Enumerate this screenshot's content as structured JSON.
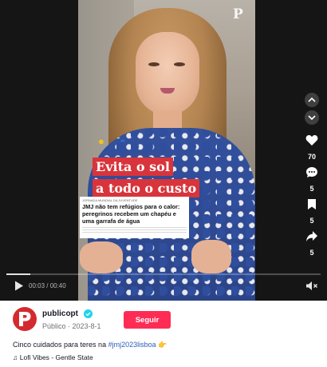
{
  "video": {
    "watermark": "P",
    "overlay_line1": "Evita o sol",
    "overlay_line2": "a todo o custo",
    "article_kicker": "JORNADA MUNDIAL DA JUVENTUDE",
    "article_title": "JMJ não tem refúgios para o calor: peregrinos recebem um chapéu e uma garrafa de água",
    "emojis": [
      "sun-emoji",
      "cap-emoji"
    ]
  },
  "actions": {
    "like_count": "70",
    "comment_count": "5",
    "save_count": "5",
    "share_count": "5"
  },
  "player": {
    "time": "00:03 / 00:40",
    "progress": 0.075
  },
  "author": {
    "channel": "publicopt",
    "meta": "Público · 2023-8-1",
    "follow_label": "Seguir"
  },
  "caption": {
    "text": "Cinco cuidados para teres na ",
    "hashtag": "#jmj2023lisboa",
    "emoji": "👉"
  },
  "music": {
    "label": "Lofi Vibes - Gentle State"
  },
  "colors": {
    "follow": "#fe2c55",
    "hashtag": "#2b5db9",
    "verified": "#20d5ec",
    "brand": "#d42a2f"
  }
}
